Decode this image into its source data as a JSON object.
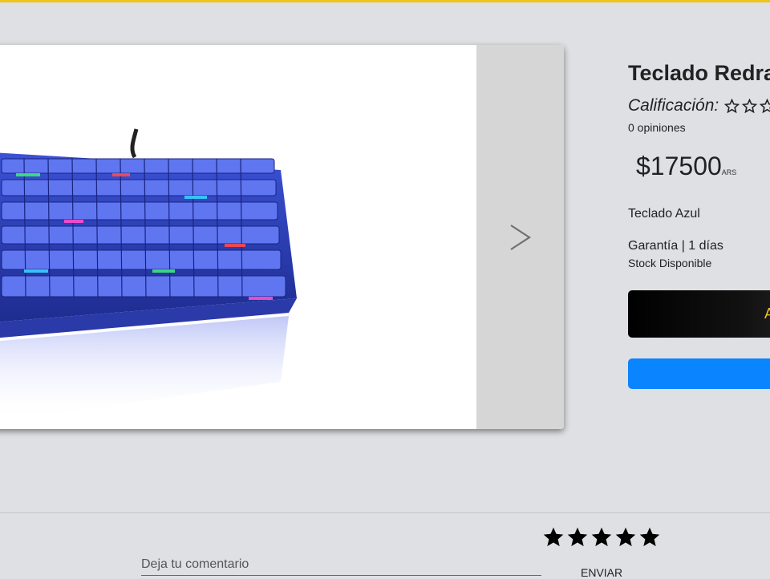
{
  "product": {
    "title": "Teclado Redra",
    "rating_label": "Calificación:",
    "rating_value": 0,
    "rating_max": 5,
    "reviews_text": "0 opiniones",
    "price_amount": "$17500",
    "price_currency": "ARS",
    "variant": "Teclado Azul",
    "warranty": "Garantía | 1 días",
    "stock": "Stock Disponible"
  },
  "actions": {
    "add_button_label": "A",
    "blue_button_label": ""
  },
  "gallery": {
    "image_subject": "blue-rgb-mechanical-keyboard",
    "next_icon": "chevron-right-icon"
  },
  "comment": {
    "placeholder": "Deja tu comentario",
    "value": "",
    "star_count": 5,
    "send_label": "ENVIAR"
  },
  "colors": {
    "accent_yellow": "#f0c419",
    "primary_blue": "#0a84ff",
    "button_black": "#000000",
    "page_bg": "#dee0e3"
  }
}
